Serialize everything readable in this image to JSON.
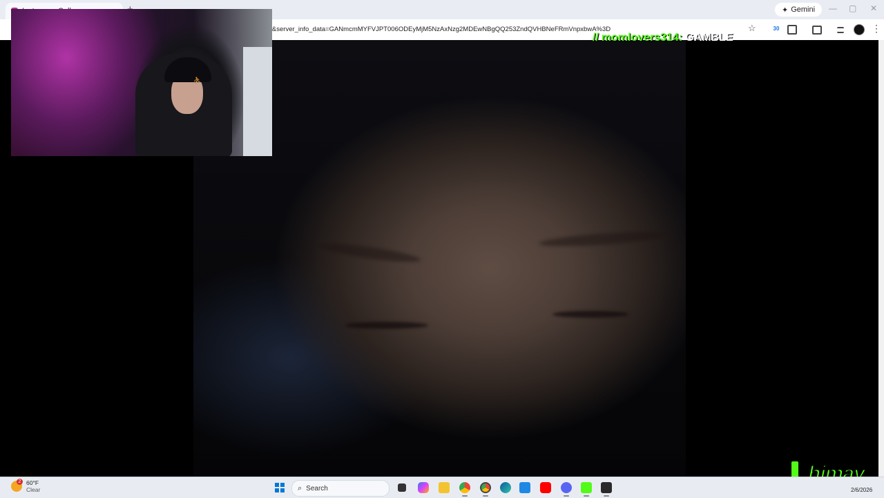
{
  "browser": {
    "tab_title": "Instagram Call",
    "tab_close": "×",
    "new_tab": "+",
    "gemini_label": "Gemini",
    "gemini_glyph": "✦",
    "address_url": "f1&server_info_data=GANmcmMYFVJPT006ODEyMjM5NzAxNzg2MDEwNBgQQ253ZndQVHBNeFRmVnpxbwA%3D",
    "bookmark_glyph": "☆",
    "extension_badge": "30",
    "menu_glyph": "⋮",
    "window_controls": {
      "minimize": "—",
      "maximize": "▢",
      "close": "✕"
    }
  },
  "stream_overlay": {
    "kick_glyph": "//",
    "username": "momlovers314:",
    "command": "GAMBLE",
    "brand_logo": "himay"
  },
  "taskbar": {
    "weather": {
      "temp": "60°F",
      "condition": "Clear",
      "badge": "2"
    },
    "search_placeholder": "Search",
    "search_glyph": "⌕",
    "date": "2/6/2026"
  },
  "colors": {
    "kick_green": "#53fc18",
    "chrome_bg": "#e9edf3",
    "taskbar_bg": "#e8ecf2"
  }
}
